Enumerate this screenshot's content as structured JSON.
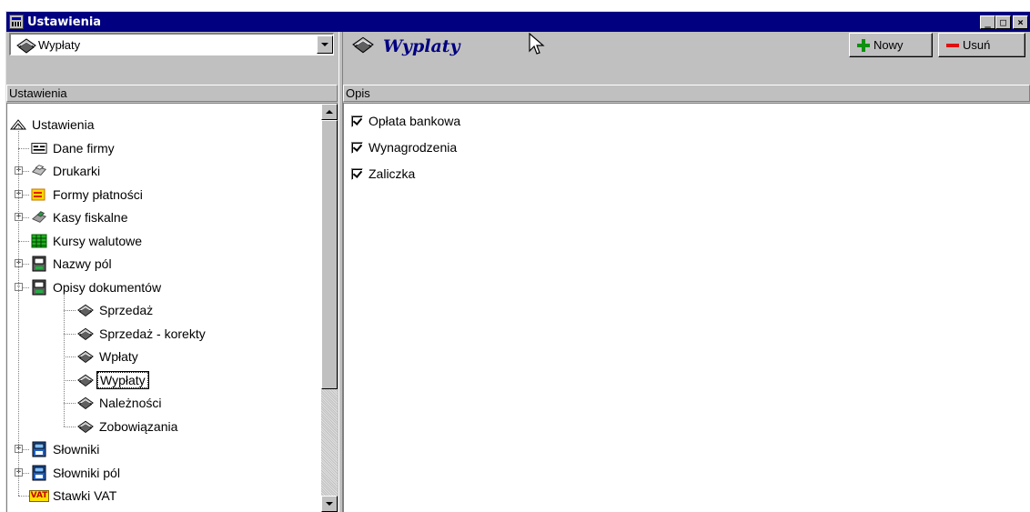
{
  "window": {
    "title": "Ustawienia"
  },
  "title_buttons": {
    "minimize": "_",
    "maximize": "□",
    "close": "×"
  },
  "left": {
    "combo_value": "Wypłaty",
    "header": "Ustawienia",
    "tree": [
      {
        "label": "Ustawienia",
        "icon": "settings-root-icon"
      },
      {
        "label": "Dane firmy",
        "icon": "company-card-icon"
      },
      {
        "label": "Drukarki",
        "icon": "printer-icon"
      },
      {
        "label": "Formy płatności",
        "icon": "payment-forms-icon"
      },
      {
        "label": "Kasy fiskalne",
        "icon": "cash-register-icon"
      },
      {
        "label": "Kursy walutowe",
        "icon": "exchange-rates-icon"
      },
      {
        "label": "Nazwy pól",
        "icon": "field-names-icon"
      },
      {
        "label": "Opisy dokumentów",
        "icon": "document-descriptions-icon"
      },
      {
        "label": "Sprzedaż",
        "icon": "book-icon"
      },
      {
        "label": "Sprzedaż - korekty",
        "icon": "book-icon"
      },
      {
        "label": "Wpłaty",
        "icon": "book-icon"
      },
      {
        "label": "Wypłaty",
        "icon": "book-icon"
      },
      {
        "label": "Należności",
        "icon": "book-icon"
      },
      {
        "label": "Zobowiązania",
        "icon": "book-icon"
      },
      {
        "label": "Słowniki",
        "icon": "dictionary-icon"
      },
      {
        "label": "Słowniki pól",
        "icon": "dictionary-icon"
      },
      {
        "label": "Stawki VAT",
        "icon": "vat-icon"
      }
    ],
    "vat_badge": "VAT"
  },
  "right": {
    "title": "Wyplaty",
    "new_button": "Nowy",
    "delete_button": "Usuń",
    "column_header": "Opis",
    "items": [
      {
        "label": "Opłata bankowa",
        "checked": true
      },
      {
        "label": "Wynagrodzenia",
        "checked": true
      },
      {
        "label": "Zaliczka",
        "checked": true
      }
    ]
  },
  "colors": {
    "titlebar": "#000080",
    "title_text": "#000080",
    "plus": "#109010",
    "minus": "#e01010"
  }
}
